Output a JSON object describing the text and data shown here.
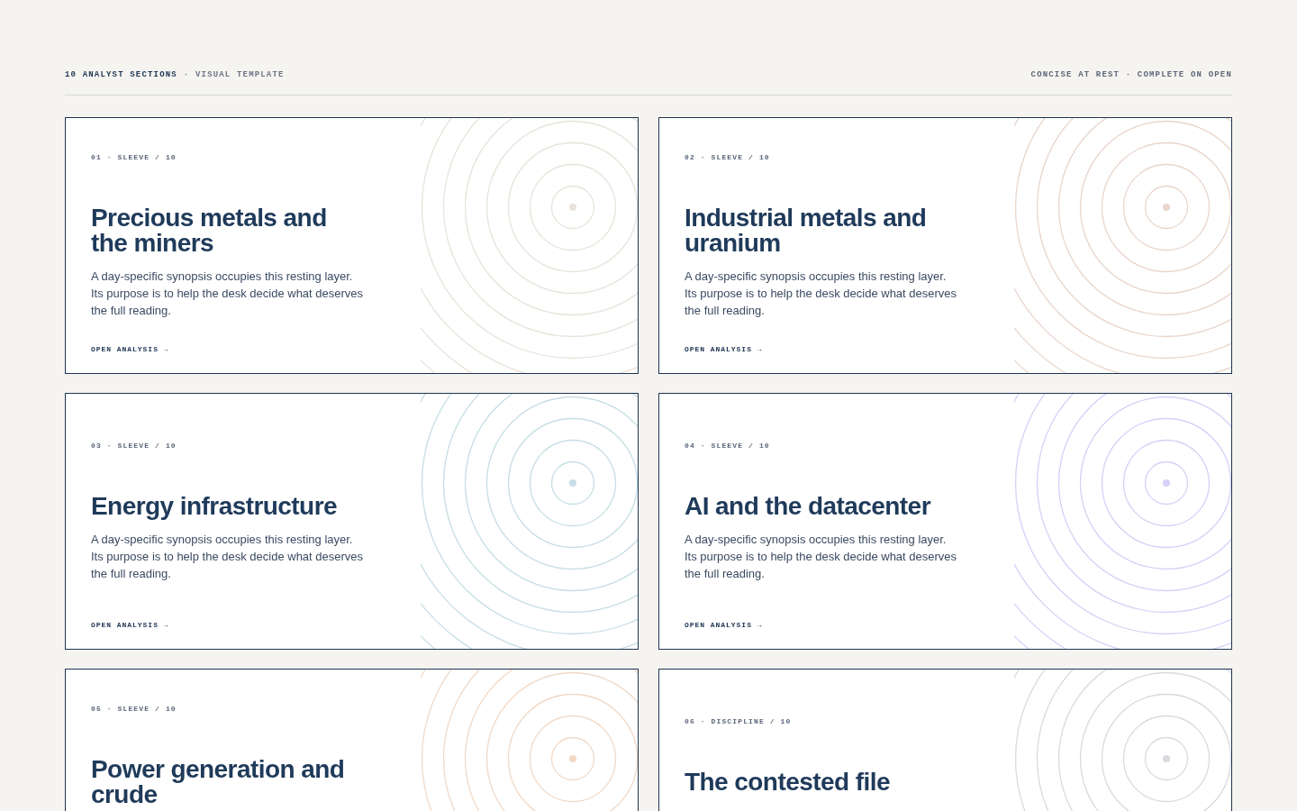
{
  "header": {
    "title": "10 ANALYST SECTIONS",
    "subtitle": "· VISUAL TEMPLATE",
    "note": "CONCISE AT REST · COMPLETE ON OPEN"
  },
  "cards": [
    {
      "label": "01 · SLEEVE / 10",
      "title": "Precious metals and the miners",
      "summary": "A day-specific synopsis occupies this resting layer. Its purpose is to help the desk decide what deserves the full reading.",
      "link": "OPEN ANALYSIS →",
      "color": "#e8e3da"
    },
    {
      "label": "02 · SLEEVE / 10",
      "title": "Industrial metals and uranium",
      "summary": "A day-specific synopsis occupies this resting layer. Its purpose is to help the desk decide what deserves the full reading.",
      "link": "OPEN ANALYSIS →",
      "color": "#e8d5cb"
    },
    {
      "label": "03 · SLEEVE / 10",
      "title": "Energy infrastructure",
      "summary": "A day-specific synopsis occupies this resting layer. Its purpose is to help the desk decide what deserves the full reading.",
      "link": "OPEN ANALYSIS →",
      "color": "#c6dee5"
    },
    {
      "label": "04 · SLEEVE / 10",
      "title": "AI and the datacenter",
      "summary": "A day-specific synopsis occupies this resting layer. Its purpose is to help the desk decide what deserves the full reading.",
      "link": "OPEN ANALYSIS →",
      "color": "#d7d0f6"
    },
    {
      "label": "05 · SLEEVE / 10",
      "title": "Power generation and crude",
      "color": "#f1d9c6"
    },
    {
      "label": "06 · DISCIPLINE / 10",
      "title": "The contested file",
      "color": "#d9dadf"
    }
  ]
}
